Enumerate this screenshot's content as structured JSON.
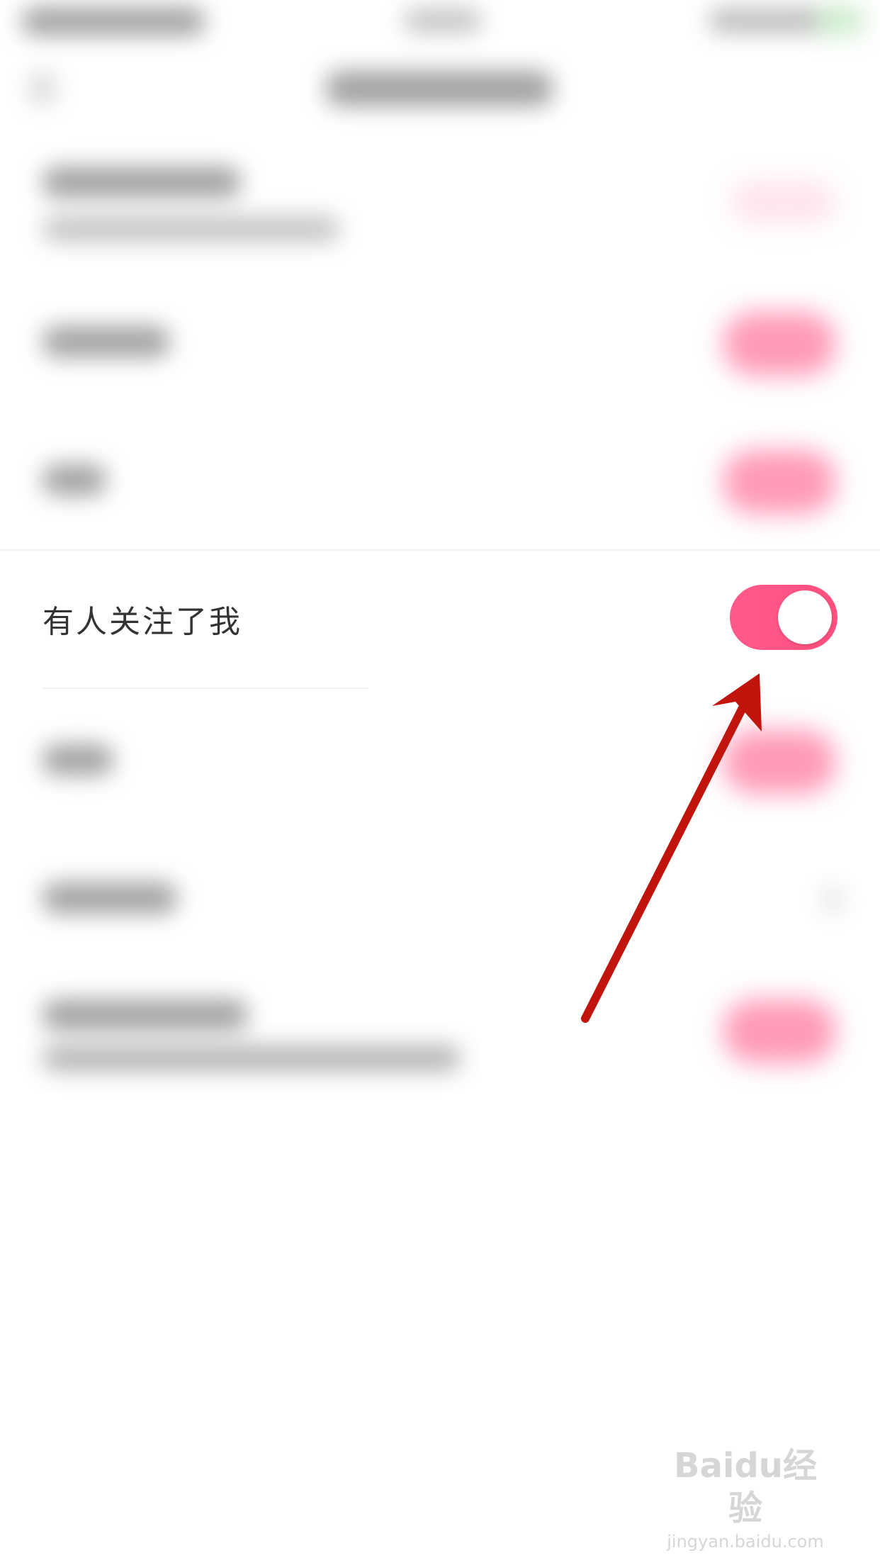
{
  "settings": {
    "highlighted_row": {
      "label": "有人关注了我",
      "toggle_on": true
    }
  },
  "colors": {
    "toggle_on": "#ff5a8a",
    "text": "#333333",
    "annotation_arrow": "#c0140c"
  },
  "watermark": {
    "top": "Baidu经验",
    "bottom": "jingyan.baidu.com"
  }
}
